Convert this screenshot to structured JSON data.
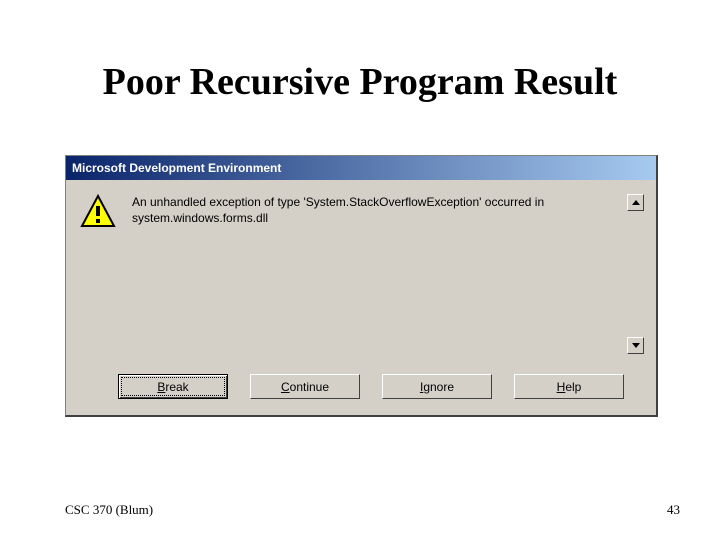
{
  "slide": {
    "title": "Poor Recursive Program Result",
    "footer_left": "CSC 370 (Blum)",
    "footer_right": "43"
  },
  "dialog": {
    "title": "Microsoft Development Environment",
    "message": "An unhandled exception of type 'System.StackOverflowException' occurred in system.windows.forms.dll",
    "buttons": {
      "break": {
        "mnemonic": "B",
        "rest": "reak"
      },
      "continue": {
        "mnemonic": "C",
        "rest": "ontinue"
      },
      "ignore": {
        "mnemonic": "I",
        "rest": "gnore"
      },
      "help": {
        "mnemonic": "H",
        "rest": "elp"
      }
    }
  }
}
